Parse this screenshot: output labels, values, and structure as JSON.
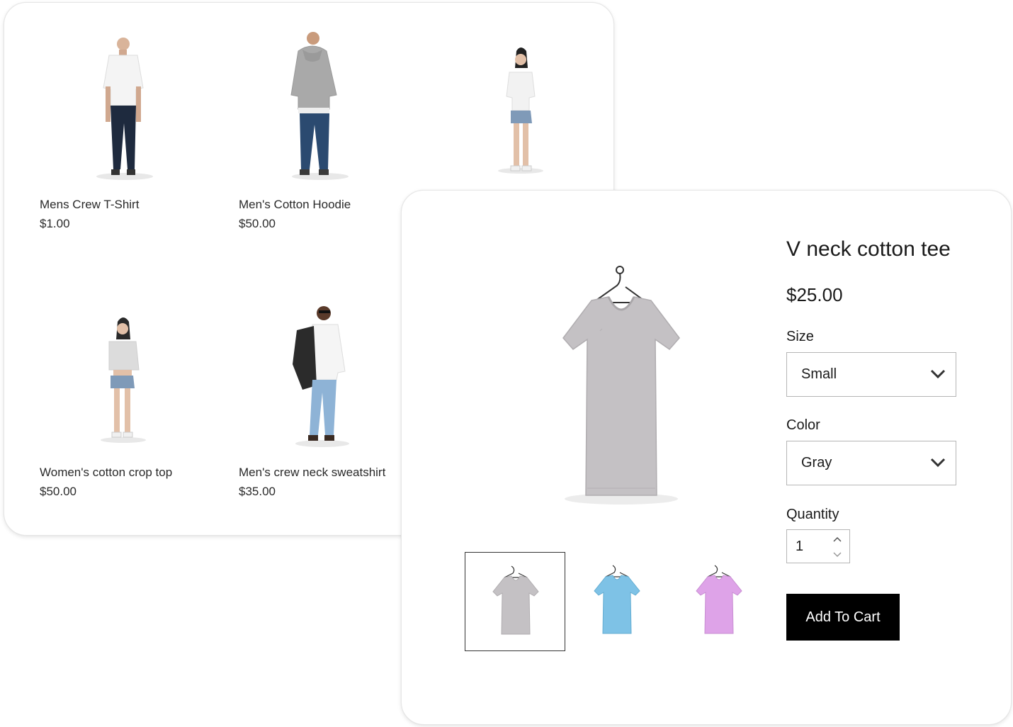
{
  "catalog": {
    "products": [
      {
        "name": "Mens Crew T-Shirt",
        "price": "$1.00"
      },
      {
        "name": "Men's Cotton Hoodie",
        "price": "$50.00"
      },
      {
        "name": "",
        "price": ""
      },
      {
        "name": "Women's cotton crop top",
        "price": "$50.00"
      },
      {
        "name": "Men's crew neck sweatshirt",
        "price": "$35.00"
      }
    ]
  },
  "product": {
    "title": "V neck cotton tee",
    "price": "$25.00",
    "size_label": "Size",
    "size_value": "Small",
    "color_label": "Color",
    "color_value": "Gray",
    "quantity_label": "Quantity",
    "quantity_value": "1",
    "add_to_cart_label": "Add To Cart",
    "thumbnails": [
      {
        "icon": "tshirt-gray-icon",
        "color": "#c4c1c4"
      },
      {
        "icon": "tshirt-blue-icon",
        "color": "#7ec2e6"
      },
      {
        "icon": "tshirt-pink-icon",
        "color": "#dea3e8"
      }
    ]
  },
  "colors": {
    "shirt_gray": "#c4c1c4",
    "button_bg": "#000000",
    "button_text": "#ffffff"
  }
}
